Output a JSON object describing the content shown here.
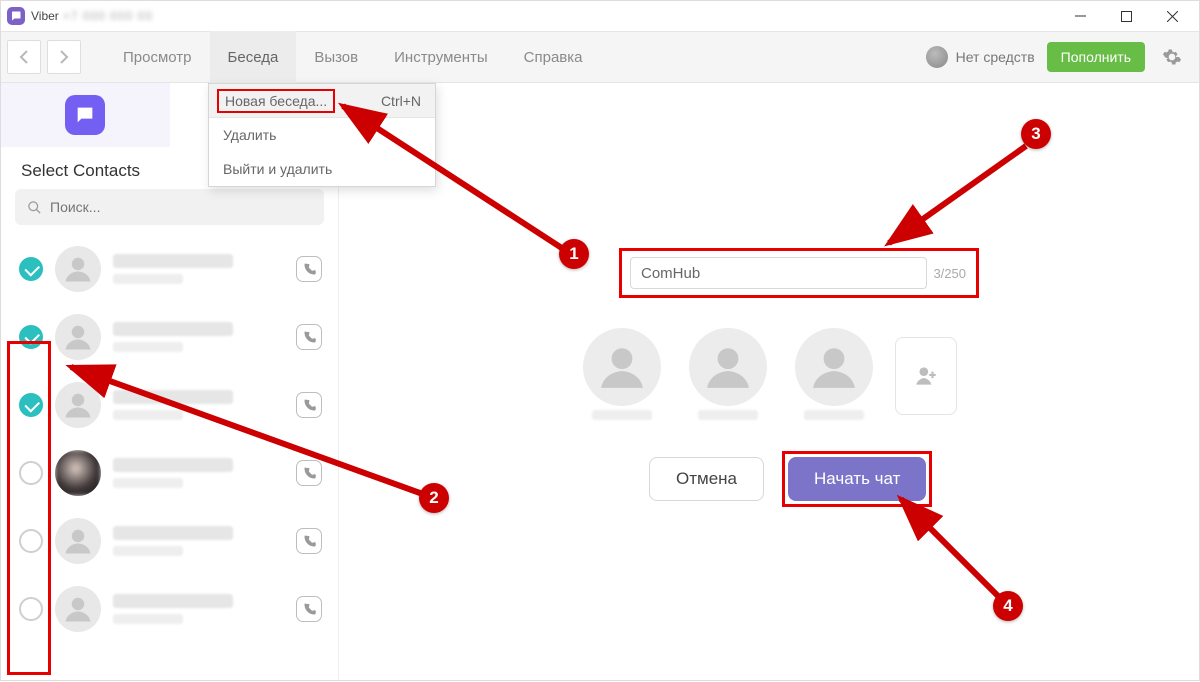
{
  "titlebar": {
    "app": "Viber"
  },
  "menu": {
    "items": [
      "Просмотр",
      "Беседа",
      "Вызов",
      "Инструменты",
      "Справка"
    ],
    "balance": "Нет средств",
    "topup": "Пополнить"
  },
  "dropdown": {
    "new_chat": "Новая беседа...",
    "shortcut": "Ctrl+N",
    "delete": "Удалить",
    "leave_delete": "Выйти и удалить"
  },
  "sidebar": {
    "title": "Select Contacts",
    "search_placeholder": "Поиск...",
    "contacts": [
      {
        "checked": true
      },
      {
        "checked": true
      },
      {
        "checked": true
      },
      {
        "checked": false,
        "photo": true
      },
      {
        "checked": false
      },
      {
        "checked": false
      }
    ]
  },
  "main": {
    "name_input": "ComHub",
    "counter": "3/250",
    "cancel": "Отмена",
    "start": "Начать чат"
  },
  "annotations": {
    "b1": "1",
    "b2": "2",
    "b3": "3",
    "b4": "4"
  }
}
